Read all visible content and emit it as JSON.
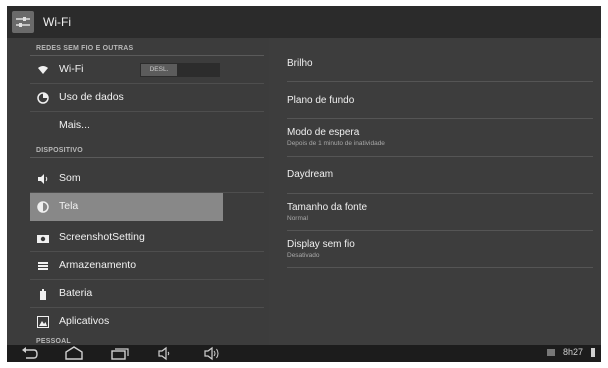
{
  "header": {
    "title": "Wi-Fi",
    "icon": "settings-sliders-icon"
  },
  "sidebar": {
    "section_wireless": "REDES SEM FIO E OUTRAS",
    "wifi_label": "Wi-Fi",
    "wifi_toggle": "DESL.",
    "data_usage_label": "Uso de dados",
    "more_label": "Mais...",
    "section_device": "DISPOSITIVO",
    "sound_label": "Som",
    "display_label": "Tela",
    "screenshot_label": "ScreenshotSetting",
    "storage_label": "Armazenamento",
    "battery_label": "Bateria",
    "apps_label": "Aplicativos",
    "section_personal": "PESSOAL"
  },
  "detail": {
    "brightness": "Brilho",
    "wallpaper": "Plano de fundo",
    "sleep": "Modo de espera",
    "sleep_sub": "Depois de 1 minuto de inatividade",
    "daydream": "Daydream",
    "font_size": "Tamanho da fonte",
    "font_size_sub": "Normal",
    "wireless_display": "Display sem fio",
    "wireless_display_sub": "Desativado"
  },
  "statusbar": {
    "time": "8h27"
  },
  "colors": {
    "selected_bg": "#888888",
    "background": "#3a3a3a",
    "navbar": "#1c1c1c"
  }
}
